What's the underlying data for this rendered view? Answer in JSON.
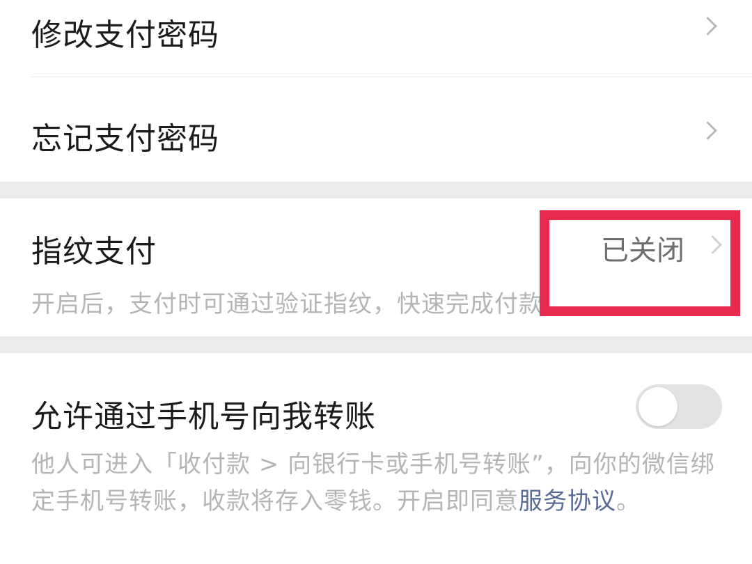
{
  "rows": {
    "change_password": {
      "label": "修改支付密码"
    },
    "forgot_password": {
      "label": "忘记支付密码"
    },
    "fingerprint": {
      "label": "指纹支付",
      "status": "已关闭",
      "description": "开启后，支付时可通过验证指纹，快速完成付款。"
    },
    "phone_transfer": {
      "label": "允许通过手机号向我转账",
      "toggle_on": false,
      "description_prefix": "他人可进入「收付款 > 向银行卡或手机号转账”，向你的微信绑定手机号转账，收款将存入零钱。开启即同意",
      "link_text": "服务协议",
      "description_suffix": "。"
    }
  },
  "colors": {
    "highlight": "#e8294e",
    "link": "#576b95"
  }
}
